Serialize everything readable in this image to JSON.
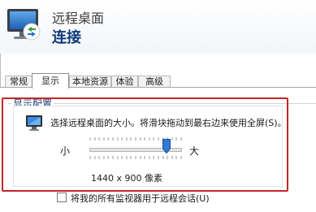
{
  "header": {
    "app_name": "远程桌面",
    "subtitle": "连接"
  },
  "tabs": [
    {
      "label": "常规",
      "active": false
    },
    {
      "label": "显示",
      "active": true
    },
    {
      "label": "本地资源",
      "active": false
    },
    {
      "label": "体验",
      "active": false
    },
    {
      "label": "高级",
      "active": false
    }
  ],
  "display_config": {
    "group_title": "显示配置",
    "description": "选择远程桌面的大小。将滑块拖动到最右边来使用全屏(S)。",
    "slider": {
      "min_label": "小",
      "max_label": "大",
      "value_fraction": 0.85,
      "resolution_text": "1440 x 900 像素"
    },
    "all_monitors_checkbox": {
      "label": "将我的所有监视器用于远程会话(U)",
      "checked": false
    }
  },
  "colors": {
    "highlight_border": "#c22727",
    "title_blue": "#0e3a7a",
    "slider_thumb": "#2f7bd6"
  },
  "icons": {
    "app": "remote-desktop-monitor-icon",
    "display": "display-monitor-icon"
  }
}
